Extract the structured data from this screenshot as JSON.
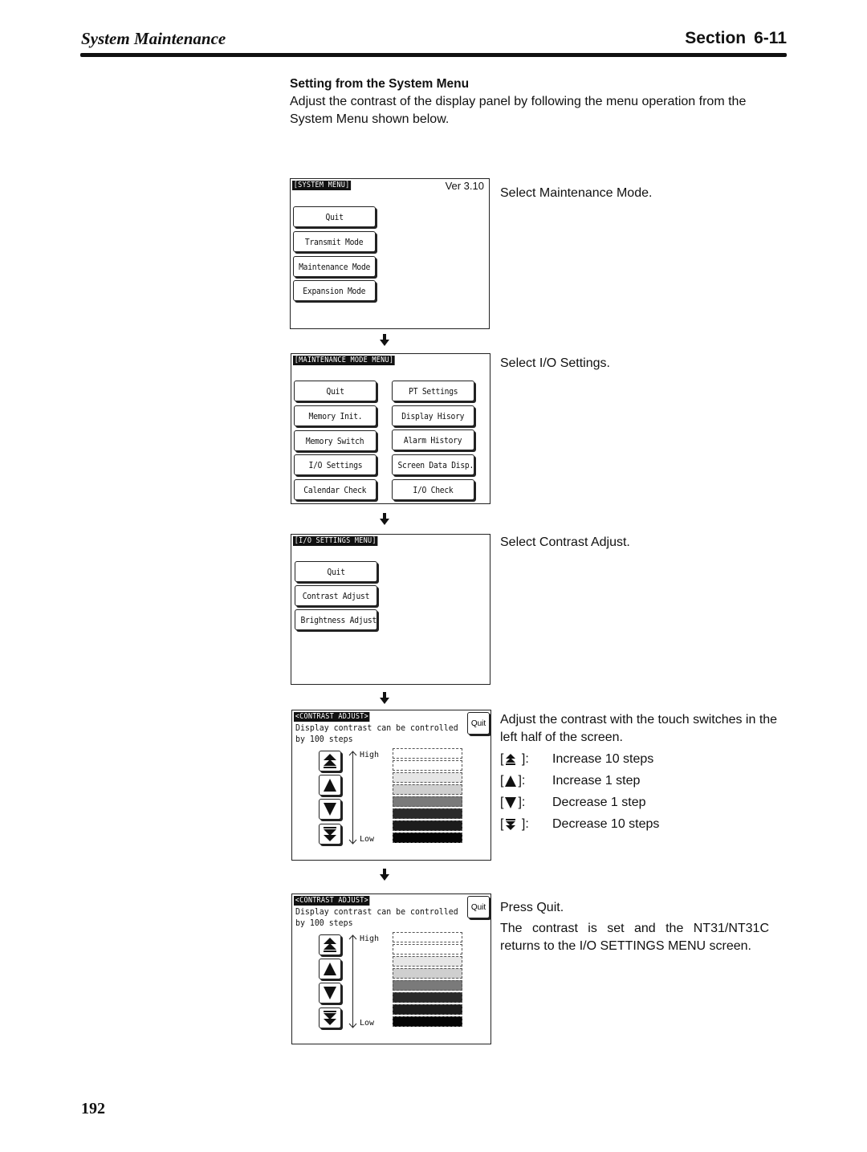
{
  "header": {
    "chapter_title": "System Maintenance",
    "section_label": "Section",
    "section_number": "6-11"
  },
  "subsection": {
    "title": "Setting from the System Menu",
    "intro": "Adjust the contrast of the display panel by following the menu operation from the System Menu shown below."
  },
  "screens": {
    "system_menu": {
      "title": "[SYSTEM MENU]",
      "version": "Ver 3.10",
      "buttons": [
        "Quit",
        "Transmit Mode",
        "Maintenance Mode",
        "Expansion Mode"
      ],
      "instruction": "Select Maintenance Mode."
    },
    "maintenance_menu": {
      "title": "[MAINTENANCE MODE MENU]",
      "left_buttons": [
        "Quit",
        "Memory Init.",
        "Memory Switch",
        "I/O Settings",
        "Calendar Check"
      ],
      "right_buttons": [
        "PT Settings",
        "Display Hisory",
        "Alarm History",
        "Screen Data Disp.",
        "I/O Check"
      ],
      "instruction": "Select I/O Settings."
    },
    "io_settings_menu": {
      "title": "[I/O SETTINGS MENU]",
      "buttons": [
        "Quit",
        "Contrast Adjust",
        "Brightness Adjust"
      ],
      "instruction": "Select Contrast Adjust."
    },
    "contrast_adjust": {
      "title": "<CONTRAST ADJUST>",
      "description_line1": "Display contrast can be controlled",
      "description_line2": "by 100 steps",
      "quit_label": "Quit",
      "high_label": "High",
      "low_label": "Low",
      "step_buttons": [
        "increase-10-steps",
        "increase-1-step",
        "decrease-1-step",
        "decrease-10-steps"
      ],
      "bar_shades": [
        "#ffffff",
        "#ffffff",
        "#e6e6e6",
        "#cfcfcf",
        "#7a7a7a",
        "#2a2a2a",
        "#1c1c1c",
        "#050505"
      ],
      "instruction": "Adjust the contrast with the touch switches in the left half of the screen.",
      "legend": [
        {
          "icon": "double-up-arrow",
          "label": "Increase 10 steps"
        },
        {
          "icon": "up-arrow",
          "label": "Increase 1 step"
        },
        {
          "icon": "down-arrow",
          "label": "Decrease 1 step"
        },
        {
          "icon": "double-down-arrow",
          "label": "Decrease 10 steps"
        }
      ]
    },
    "contrast_quit": {
      "instruction_1": "Press Quit.",
      "instruction_2": "The contrast is set and the NT31/NT31C returns to the I/O SETTINGS MENU screen."
    }
  },
  "page_number": "192"
}
